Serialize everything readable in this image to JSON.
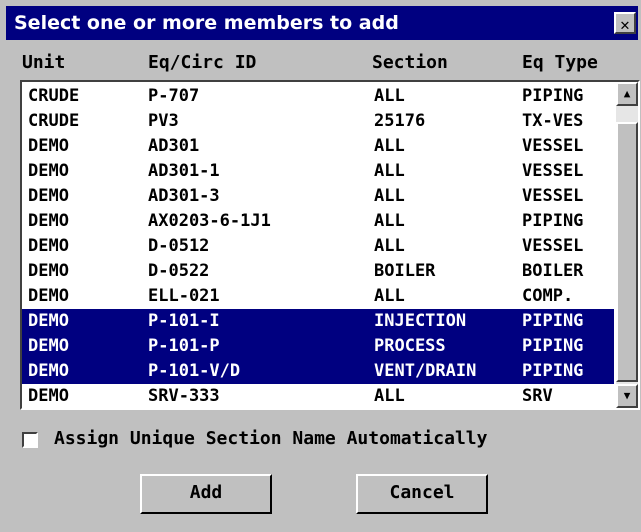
{
  "dialog": {
    "title": "Select one or more members to add",
    "close_glyph": "✕"
  },
  "columns": {
    "unit": "Unit",
    "id": "Eq/Circ ID",
    "section": "Section",
    "type": "Eq Type"
  },
  "rows": [
    {
      "unit": "CRUDE",
      "id": "P-707",
      "section": "ALL",
      "type": "PIPING",
      "selected": false
    },
    {
      "unit": "CRUDE",
      "id": "PV3",
      "section": "25176",
      "type": "TX-VES",
      "selected": false
    },
    {
      "unit": "DEMO",
      "id": "AD301",
      "section": "ALL",
      "type": "VESSEL",
      "selected": false
    },
    {
      "unit": "DEMO",
      "id": "AD301-1",
      "section": "ALL",
      "type": "VESSEL",
      "selected": false
    },
    {
      "unit": "DEMO",
      "id": "AD301-3",
      "section": "ALL",
      "type": "VESSEL",
      "selected": false
    },
    {
      "unit": "DEMO",
      "id": "AX0203-6-1J1",
      "section": "ALL",
      "type": "PIPING",
      "selected": false
    },
    {
      "unit": "DEMO",
      "id": "D-0512",
      "section": "ALL",
      "type": "VESSEL",
      "selected": false
    },
    {
      "unit": "DEMO",
      "id": "D-0522",
      "section": "BOILER",
      "type": "BOILER",
      "selected": false
    },
    {
      "unit": "DEMO",
      "id": "ELL-021",
      "section": "ALL",
      "type": "COMP.",
      "selected": false
    },
    {
      "unit": "DEMO",
      "id": "P-101-I",
      "section": "INJECTION",
      "type": "PIPING",
      "selected": true
    },
    {
      "unit": "DEMO",
      "id": "P-101-P",
      "section": "PROCESS",
      "type": "PIPING",
      "selected": true
    },
    {
      "unit": "DEMO",
      "id": "P-101-V/D",
      "section": "VENT/DRAIN",
      "type": "PIPING",
      "selected": true
    },
    {
      "unit": "DEMO",
      "id": "SRV-333",
      "section": "ALL",
      "type": "SRV",
      "selected": false
    }
  ],
  "scrollbar": {
    "up_glyph": "▲",
    "down_glyph": "▼"
  },
  "assign": {
    "label": "Assign Unique Section Name Automatically",
    "checked": false
  },
  "buttons": {
    "add": "Add",
    "cancel": "Cancel"
  },
  "colors": {
    "selection": "#000080",
    "face": "#c0c0c0"
  }
}
